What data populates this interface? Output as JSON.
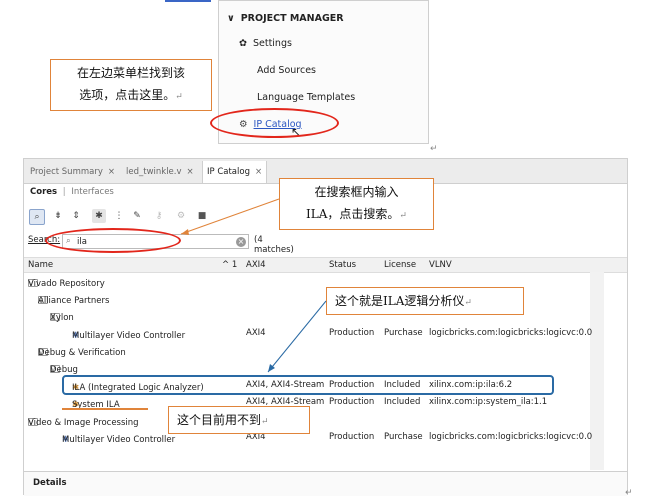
{
  "project_manager": {
    "title": "PROJECT MANAGER",
    "settings": "Settings",
    "add_sources": "Add Sources",
    "language_templates": "Language Templates",
    "ip_catalog": "IP Catalog"
  },
  "notes": {
    "find_menu_line1": "在左边菜单栏找到该",
    "find_menu_line2": "选项，点击这里。",
    "search_line1": "在搜索框内输入",
    "search_line2": "ILA，点击搜索。",
    "ila_note": "这个就是ILA逻辑分析仪",
    "unused_note": "这个目前用不到",
    "enter_mark": "↵"
  },
  "tabs": [
    {
      "label": "Project Summary",
      "close": "×"
    },
    {
      "label": "led_twinkle.v",
      "close": "×"
    },
    {
      "label": "IP Catalog",
      "close": "×"
    }
  ],
  "subtabs": {
    "cores": "Cores",
    "sep": "|",
    "interfaces": "Interfaces"
  },
  "toolbar_icons": [
    "search-icon",
    "collapse-all-icon",
    "expand-all-icon",
    "filter-icon",
    "hierarchy-icon",
    "wrench-icon",
    "key-icon",
    "settings-icon",
    "stop-icon"
  ],
  "search": {
    "label": "Search:",
    "value": "ila",
    "matches": "(4 matches)",
    "icon": "⌕",
    "clear": "×"
  },
  "columns": {
    "name": "Name",
    "sort": "^ 1",
    "axi4": "AXI4",
    "status": "Status",
    "license": "License",
    "vlnv": "VLNV"
  },
  "rows": [
    {
      "name": "Vivado Repository",
      "axi4": "",
      "status": "",
      "license": "",
      "vlnv": ""
    },
    {
      "name": "Alliance Partners",
      "axi4": "",
      "status": "",
      "license": "",
      "vlnv": ""
    },
    {
      "name": "Xylon",
      "axi4": "",
      "status": "",
      "license": "",
      "vlnv": ""
    },
    {
      "name": "Multilayer Video Controller",
      "axi4": "AXI4",
      "status": "Production",
      "license": "Purchase",
      "vlnv": "logicbricks.com:logicbricks:logicvc:0.0"
    },
    {
      "name": "Debug & Verification",
      "axi4": "",
      "status": "",
      "license": "",
      "vlnv": ""
    },
    {
      "name": "Debug",
      "axi4": "",
      "status": "",
      "license": "",
      "vlnv": ""
    },
    {
      "name": "ILA (Integrated Logic Analyzer)",
      "axi4": "AXI4, AXI4-Stream",
      "status": "Production",
      "license": "Included",
      "vlnv": "xilinx.com:ip:ila:6.2"
    },
    {
      "name": "System ILA",
      "axi4": "AXI4, AXI4-Stream",
      "status": "Production",
      "license": "Included",
      "vlnv": "xilinx.com:ip:system_ila:1.1"
    },
    {
      "name": "Video & Image Processing",
      "axi4": "",
      "status": "",
      "license": "",
      "vlnv": ""
    },
    {
      "name": "Multilayer Video Controller",
      "axi4": "AXI4",
      "status": "Production",
      "license": "Purchase",
      "vlnv": "logicbricks.com:logicbricks:logicvc:0.0"
    }
  ],
  "details": {
    "label": "Details"
  },
  "colors": {
    "accent": "#2b56c2",
    "annotation_red": "#e2261b",
    "annotation_orange": "#e0843a",
    "annotation_blue": "#2a6aa4"
  }
}
